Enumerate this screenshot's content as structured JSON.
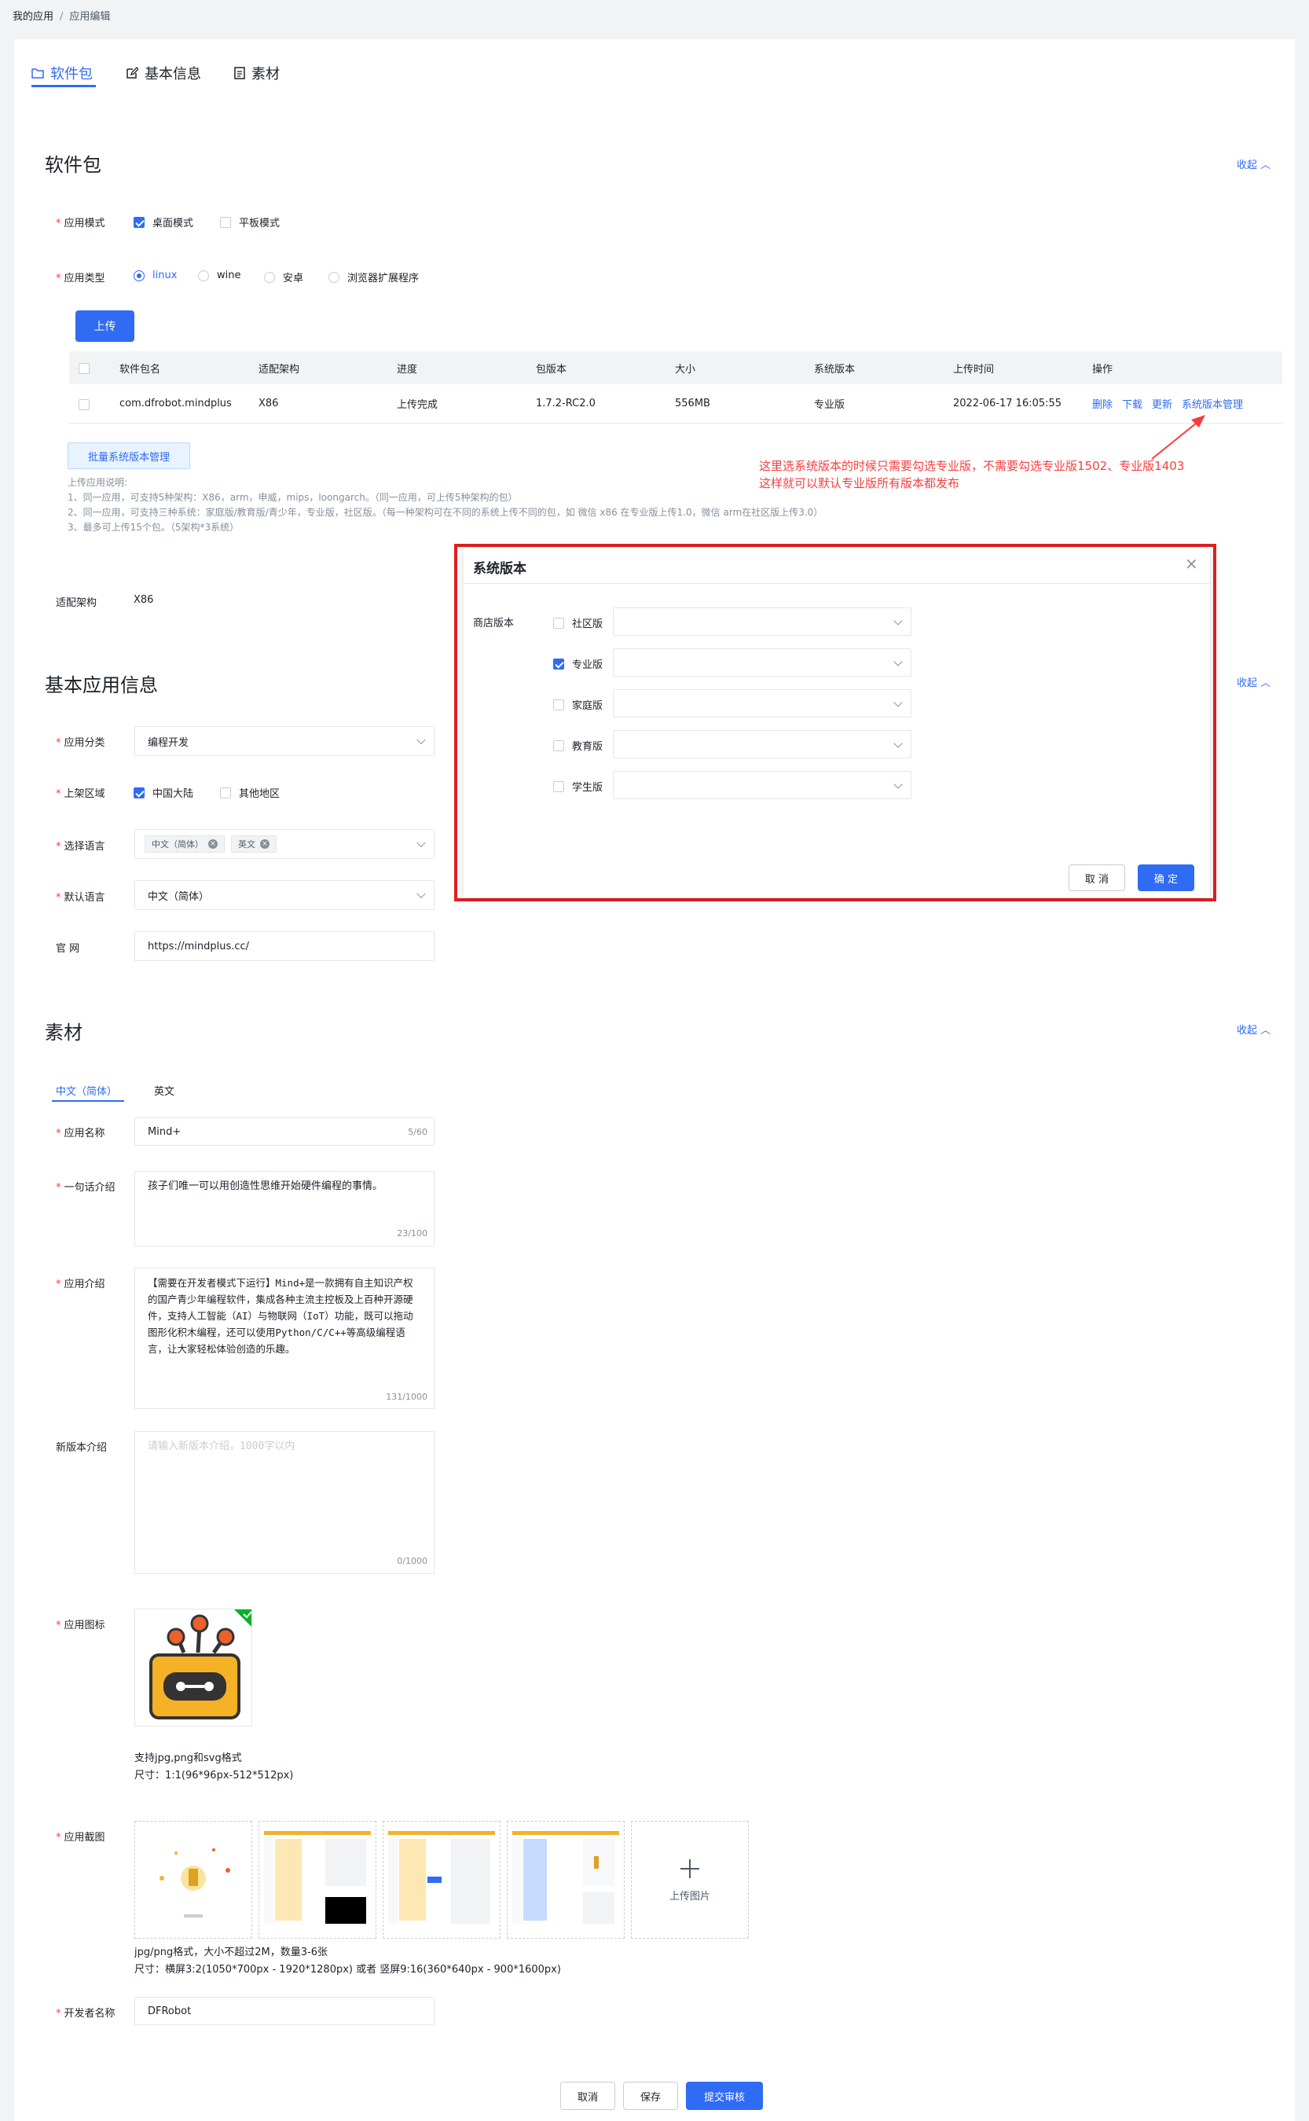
{
  "breadcrumb": {
    "root": "我的应用",
    "sep": "/",
    "current": "应用编辑"
  },
  "tabs": [
    {
      "label": "软件包",
      "icon": "folder-icon",
      "active": true
    },
    {
      "label": "基本信息",
      "icon": "edit-icon",
      "active": false
    },
    {
      "label": "素材",
      "icon": "file-icon",
      "active": false
    }
  ],
  "package": {
    "title": "软件包",
    "collapse": "收起",
    "mode_label": "应用模式",
    "mode_options": [
      {
        "label": "桌面模式",
        "checked": true
      },
      {
        "label": "平板模式",
        "checked": false
      }
    ],
    "type_label": "应用类型",
    "type_options": [
      {
        "label": "linux",
        "checked": true
      },
      {
        "label": "wine",
        "checked": false
      },
      {
        "label": "安卓",
        "checked": false
      },
      {
        "label": "浏览器扩展程序",
        "checked": false
      }
    ],
    "upload_button": "上传",
    "table": {
      "headers": [
        "软件包名",
        "适配架构",
        "进度",
        "包版本",
        "大小",
        "系统版本",
        "上传时间",
        "操作"
      ],
      "row": {
        "name": "com.dfrobot.mindplus",
        "arch": "X86",
        "progress": "上传完成",
        "version": "1.7.2-RC2.0",
        "size": "556MB",
        "system": "专业版",
        "time": "2022-06-17 16:05:55",
        "actions": [
          "删除",
          "下载",
          "更新",
          "系统版本管理"
        ]
      }
    },
    "batch_button": "批量系统版本管理",
    "notes": [
      "上传应用说明:",
      "1、同一应用，可支持5种架构：X86，arm，申威，mips，loongarch。（同一应用，可上传5种架构的包）",
      "2、同一应用，可支持三种系统：家庭版/教育版/青少年，专业版，社区版。（每一种架构可在不同的系统上传不同的包，如 微信 x86 在专业版上传1.0，微信 arm在社区版上传3.0）",
      "3、最多可上传15个包。（5架构*3系统）"
    ],
    "arch_label": "适配架构",
    "arch_value": "X86"
  },
  "annotation": {
    "line1": "这里选系统版本的时候只需要勾选专业版，不需要勾选专业版1502、专业版1403",
    "line2": "这样就可以默认专业版所有版本都发布",
    "color": "#f53f3f"
  },
  "modal": {
    "title": "系统版本",
    "close": "×",
    "store_label": "商店版本",
    "options": [
      {
        "label": "社区版",
        "checked": false
      },
      {
        "label": "专业版",
        "checked": true
      },
      {
        "label": "家庭版",
        "checked": false
      },
      {
        "label": "教育版",
        "checked": false
      },
      {
        "label": "学生版",
        "checked": false
      }
    ],
    "cancel": "取 消",
    "confirm": "确 定"
  },
  "basic": {
    "title": "基本应用信息",
    "collapse": "收起",
    "category_label": "应用分类",
    "category_value": "编程开发",
    "region_label": "上架区域",
    "region_options": [
      {
        "label": "中国大陆",
        "checked": true
      },
      {
        "label": "其他地区",
        "checked": false
      }
    ],
    "language_label": "选择语言",
    "languages": [
      "中文（简体）",
      "英文"
    ],
    "default_lang_label": "默认语言",
    "default_lang_value": "中文（简体）",
    "website_label": "官 网",
    "website_value": "https://mindplus.cc/"
  },
  "material": {
    "title": "素材",
    "collapse": "收起",
    "lang_tabs": [
      {
        "label": "中文（简体）",
        "active": true
      },
      {
        "label": "英文",
        "active": false
      }
    ],
    "name_label": "应用名称",
    "name_value": "Mind+",
    "name_count": "5/60",
    "slogan_label": "一句话介绍",
    "slogan_value": "孩子们唯一可以用创造性思维开始硬件编程的事情。",
    "slogan_count": "23/100",
    "intro_label": "应用介绍",
    "intro_value": "【需要在开发者模式下运行】Mind+是一款拥有自主知识产权的国产青少年编程软件，集成各种主流主控板及上百种开源硬件，支持人工智能（AI）与物联网（IoT）功能，既可以拖动图形化积木编程，还可以使用Python/C/C++等高级编程语言，让大家轻松体验创造的乐趣。",
    "intro_count": "131/1000",
    "new_label": "新版本介绍",
    "new_placeholder": "请输入新版本介绍，1000字以内",
    "new_count": "0/1000",
    "icon_label": "应用图标",
    "icon_hint1": "支持jpg,png和svg格式",
    "icon_hint2": "尺寸：1:1(96*96px-512*512px)",
    "shots_label": "应用截图",
    "upload_image": "上传图片",
    "shots_hint1": "jpg/png格式，大小不超过2M，数量3-6张",
    "shots_hint2": "尺寸：横屏3:2(1050*700px - 1920*1280px) 或者 竖屏9:16(360*640px - 900*1600px)",
    "dev_label": "开发者名称",
    "dev_value": "DFRobot"
  },
  "footer": {
    "cancel": "取消",
    "save": "保存",
    "submit": "提交审核"
  },
  "colors": {
    "accent": "#2f6bf3",
    "danger": "#f53f3f",
    "success": "#00b42a"
  }
}
